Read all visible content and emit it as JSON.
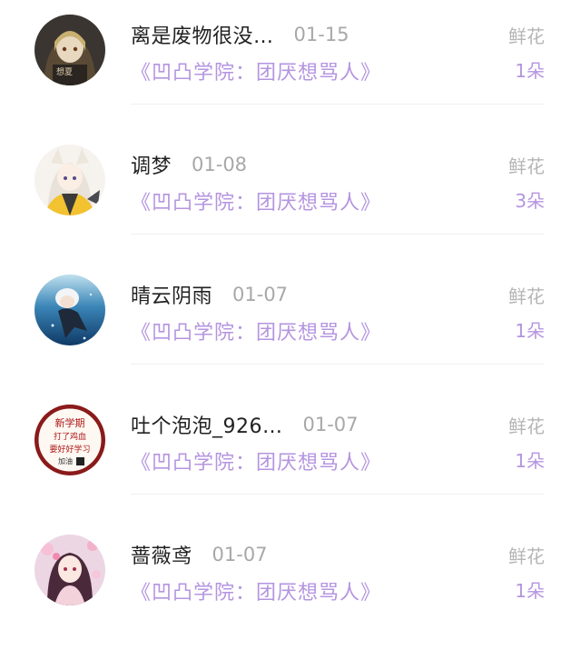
{
  "entries": [
    {
      "name": "离是废物很没…",
      "date": "01-15",
      "title": "《凹凸学院：团厌想骂人》",
      "gift_label": "鲜花",
      "gift_count": "1朵",
      "avatar_text": "想夏"
    },
    {
      "name": "调梦",
      "date": "01-08",
      "title": "《凹凸学院：团厌想骂人》",
      "gift_label": "鲜花",
      "gift_count": "3朵"
    },
    {
      "name": "晴云阴雨",
      "date": "01-07",
      "title": "《凹凸学院：团厌想骂人》",
      "gift_label": "鲜花",
      "gift_count": "1朵"
    },
    {
      "name": "吐个泡泡_926…",
      "date": "01-07",
      "title": "《凹凸学院：团厌想骂人》",
      "gift_label": "鲜花",
      "gift_count": "1朵",
      "avatar_text": [
        "新学期",
        "打了鸡血",
        "要好好学习",
        "加油"
      ]
    },
    {
      "name": "蔷薇鸢",
      "date": "01-07",
      "title": "《凹凸学院：团厌想骂人》",
      "gift_label": "鲜花",
      "gift_count": "1朵"
    }
  ]
}
